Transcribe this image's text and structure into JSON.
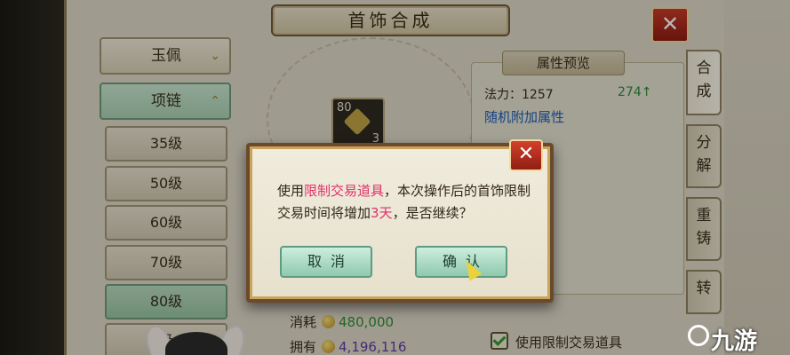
{
  "window": {
    "title": "首饰合成"
  },
  "left_menu": {
    "categories": [
      {
        "label": "玉佩",
        "chevron": "chevron-down-icon"
      },
      {
        "label": "项链",
        "chevron": "chevron-up-icon"
      }
    ],
    "levels": [
      {
        "label": "35级"
      },
      {
        "label": "50级"
      },
      {
        "label": "60级"
      },
      {
        "label": "70级"
      },
      {
        "label": "80级"
      },
      {
        "label": "级"
      }
    ],
    "selected_level": "80级"
  },
  "item_slot": {
    "level": "80",
    "count": "3"
  },
  "attributes": {
    "title": "属性预览",
    "power_label": "法力：1257",
    "power_gain": "274↑",
    "random_attr": "随机附加属性"
  },
  "side_tabs": [
    {
      "label": "合\n成"
    },
    {
      "label": "分\n解"
    },
    {
      "label": "重\n铸"
    },
    {
      "label": "转"
    }
  ],
  "costs": {
    "consume_label": "消耗",
    "consume_value": "480,000",
    "have_label": "拥有",
    "have_value": "4,196,116",
    "use_restricted_label": "使用限制交易道具"
  },
  "dialog": {
    "message_part1": "使用",
    "message_highlight1": "限制交易道具",
    "message_part2": "，本次操作后的首饰限制交易时间将增加",
    "message_highlight2": "3天",
    "message_part3": "，是否继续？",
    "cancel_label": "取消",
    "confirm_label": "确认"
  },
  "watermark": {
    "text": "九游"
  },
  "colors": {
    "highlight": "#e0306a",
    "button_green": "#8fc9ad",
    "close_red": "#c83a28",
    "power_up": "#2a8a3a",
    "random_attr": "#1c5db8"
  }
}
